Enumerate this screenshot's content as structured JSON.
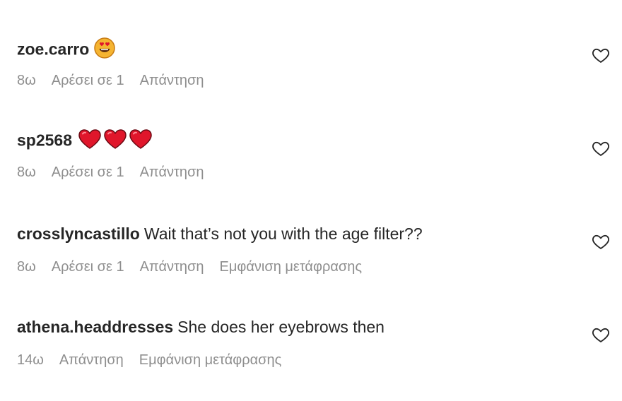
{
  "comments": [
    {
      "username": "zoe.carro",
      "text": "",
      "emoji": "heart-eyes-emoji",
      "time": "8ω",
      "likes": "Αρέσει σε 1",
      "reply": "Απάντηση",
      "translate": ""
    },
    {
      "username": "sp2568",
      "text": "",
      "emoji": "red-heart-emoji",
      "time": "8ω",
      "likes": "Αρέσει σε 1",
      "reply": "Απάντηση",
      "translate": ""
    },
    {
      "username": "crosslyncastillo",
      "text": "Wait that’s not you with the age filter??",
      "time": "8ω",
      "likes": "Αρέσει σε 1",
      "reply": "Απάντηση",
      "translate": "Εμφάνιση μετάφρασης"
    },
    {
      "username": "athena.headdresses",
      "text": "She does her eyebrows then",
      "time": "14ω",
      "likes": "",
      "reply": "Απάντηση",
      "translate": "Εμφάνιση μετάφρασης"
    }
  ],
  "colors": {
    "text": "#262626",
    "secondary": "#8e8e8e",
    "heart_red": "#e0162b"
  },
  "icons": {
    "like": "heart-outline-icon"
  }
}
